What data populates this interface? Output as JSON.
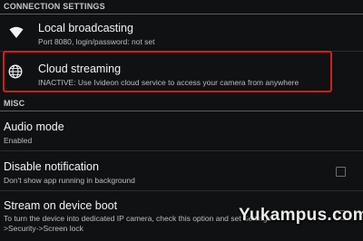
{
  "sections": {
    "connection_header": "CONNECTION SETTINGS",
    "misc_header": "MISC"
  },
  "local_broadcasting": {
    "title": "Local broadcasting",
    "subtitle": "Port 8080, login/password: not set",
    "icon": "wifi-icon"
  },
  "cloud_streaming": {
    "title": "Cloud streaming",
    "subtitle": "INACTIVE: Use Ivideon cloud service to access your camera from anywhere",
    "icon": "globe-icon",
    "highlight_color": "#e01b1b"
  },
  "audio_mode": {
    "title": "Audio mode",
    "subtitle": "Enabled"
  },
  "disable_notification": {
    "title": "Disable notification",
    "subtitle": "Don't show app running in background",
    "checked": false
  },
  "stream_on_boot": {
    "title": "Stream on device boot",
    "subtitle_line1": "To turn the device into dedicated IP camera, check this option and set Settings",
    "subtitle_line2": ">Security->Screen lock",
    "checked": false
  },
  "watermark": "Yukampus.com",
  "colors": {
    "background": "#0f1112",
    "divider": "#5a5f61",
    "text_primary": "#f4f4f4",
    "text_secondary": "#bdbdbd"
  }
}
